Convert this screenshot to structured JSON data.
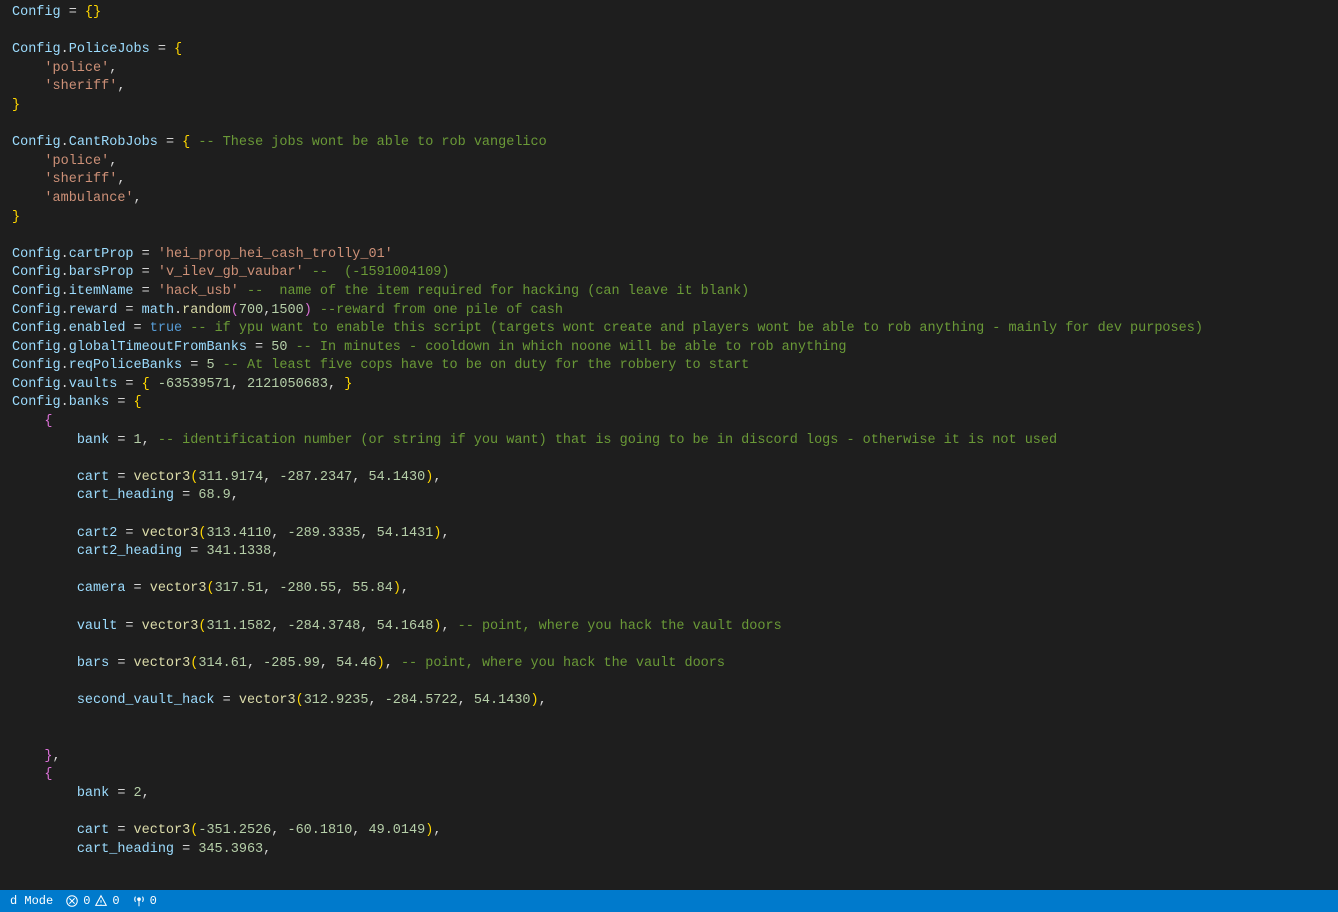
{
  "code": {
    "config": "Config",
    "empty": "{}",
    "policeJobsKey": "PoliceJobs",
    "cantRobJobsKey": "CantRobJobs",
    "cartPropKey": "cartProp",
    "barsPropKey": "barsProp",
    "itemNameKey": "itemName",
    "rewardKey": "reward",
    "enabledKey": "enabled",
    "globalTimeoutKey": "globalTimeoutFromBanks",
    "reqPoliceKey": "reqPoliceBanks",
    "vaultsKey": "vaults",
    "banksKey": "banks",
    "police": "'police'",
    "sheriff": "'sheriff'",
    "ambulance": "'ambulance'",
    "cantRobComment": "-- These jobs wont be able to rob vangelico",
    "cartPropVal": "'hei_prop_hei_cash_trolly_01'",
    "barsPropVal": "'v_ilev_gb_vaubar'",
    "barsPropComment": "--  (-1591004109)",
    "itemNameVal": "'hack_usb'",
    "itemNameComment": "--  name of the item required for hacking (can leave it blank)",
    "mathRandom": "math.random",
    "rewardArg1": "700",
    "rewardArg2": "1500",
    "rewardComment": "--reward from one pile of cash",
    "trueKw": "true",
    "enabledComment": "-- if ypu want to enable this script (targets wont create and players wont be able to rob anything - mainly for dev purposes)",
    "globalTimeoutVal": "50",
    "globalTimeoutComment": "-- In minutes - cooldown in which noone will be able to rob anything",
    "reqPoliceVal": "5",
    "reqPoliceComment": "-- At least five cops have to be on duty for the robbery to start",
    "vaultsVal1": "-63539571",
    "vaultsVal2": "2121050683",
    "bankKey": "bank",
    "bank1": "1",
    "bank1Comment": "-- identification number (or string if you want) that is going to be in discord logs - otherwise it is not used",
    "bank2": "2",
    "cartKey": "cart",
    "cart2Key": "cart2",
    "cameraKey": "camera",
    "vaultKey": "vault",
    "barsKey": "bars",
    "secondVaultKey": "second_vault_hack",
    "cartHeadingKey": "cart_heading",
    "cart2HeadingKey": "cart2_heading",
    "vector3": "vector3",
    "cart_x": "311.9174",
    "cart_y": "-287.2347",
    "cart_z": "54.1430",
    "cartHeadingVal": "68.9",
    "cart2_x": "313.4110",
    "cart2_y": "-289.3335",
    "cart2_z": "54.1431",
    "cart2HeadingVal": "341.1338",
    "cam_x": "317.51",
    "cam_y": "-280.55",
    "cam_z": "55.84",
    "vault_x": "311.1582",
    "vault_y": "-284.3748",
    "vault_z": "54.1648",
    "vaultComment": "-- point, where you hack the vault doors",
    "bars_x": "314.61",
    "bars_y": "-285.99",
    "bars_z": "54.46",
    "barsComment": "-- point, where you hack the vault doors",
    "sv_x": "312.9235",
    "sv_y": "-284.5722",
    "sv_z": "54.1430",
    "b2cart_x": "-351.2526",
    "b2cart_y": "-60.1810",
    "b2cart_z": "49.0149",
    "b2cartHeading": "345.3963"
  },
  "status": {
    "mode": "d Mode",
    "errors": "0",
    "warnings": "0",
    "ports": "0"
  }
}
